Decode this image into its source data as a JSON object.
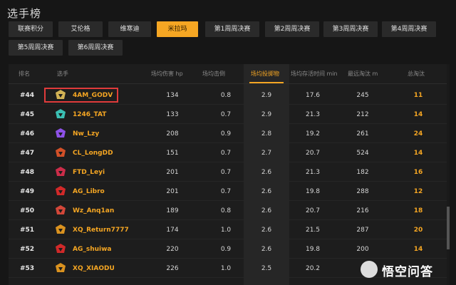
{
  "page": {
    "title": "选手榜"
  },
  "tabs": [
    {
      "label": "联赛积分",
      "active": false
    },
    {
      "label": "艾伦格",
      "active": false
    },
    {
      "label": "维寒迪",
      "active": false
    },
    {
      "label": "米拉玛",
      "active": true
    },
    {
      "label": "第1周周决赛",
      "active": false
    },
    {
      "label": "第2周周决赛",
      "active": false
    },
    {
      "label": "第3周周决赛",
      "active": false
    },
    {
      "label": "第4周周决赛",
      "active": false
    },
    {
      "label": "第5周周决赛",
      "active": false
    },
    {
      "label": "第6周周决赛",
      "active": false
    }
  ],
  "table": {
    "headers": [
      "排名",
      "选手",
      "场均伤害 hp",
      "场均击倒",
      "场均投掷物",
      "场均存活时间 min",
      "最远淘汰 m",
      "总淘汰"
    ],
    "sorted_column": "场均投掷物",
    "rows": [
      {
        "rank": "#44",
        "player": "4AM_GODV",
        "damage": "134",
        "knocks": "0.8",
        "throwables": "2.9",
        "survival": "17.6",
        "longest": "245",
        "kills": "11",
        "logo": "4am-logo"
      },
      {
        "rank": "#45",
        "player": "1246_TAT",
        "damage": "133",
        "knocks": "0.7",
        "throwables": "2.9",
        "survival": "21.3",
        "longest": "212",
        "kills": "14",
        "logo": "1246-logo"
      },
      {
        "rank": "#46",
        "player": "Nw_Lzy",
        "damage": "208",
        "knocks": "0.9",
        "throwables": "2.8",
        "survival": "19.2",
        "longest": "261",
        "kills": "24",
        "logo": "nw-logo"
      },
      {
        "rank": "#47",
        "player": "CL_LongDD",
        "damage": "151",
        "knocks": "0.7",
        "throwables": "2.7",
        "survival": "20.7",
        "longest": "524",
        "kills": "14",
        "logo": "cl-logo"
      },
      {
        "rank": "#48",
        "player": "FTD_Leyi",
        "damage": "201",
        "knocks": "0.7",
        "throwables": "2.6",
        "survival": "21.3",
        "longest": "182",
        "kills": "16",
        "logo": "ftd-logo"
      },
      {
        "rank": "#49",
        "player": "AG_Libro",
        "damage": "201",
        "knocks": "0.7",
        "throwables": "2.6",
        "survival": "19.8",
        "longest": "288",
        "kills": "12",
        "logo": "ag-logo"
      },
      {
        "rank": "#50",
        "player": "Wz_Anq1an",
        "damage": "189",
        "knocks": "0.8",
        "throwables": "2.6",
        "survival": "20.7",
        "longest": "216",
        "kills": "18",
        "logo": "wz-logo"
      },
      {
        "rank": "#51",
        "player": "XQ_Return7777",
        "damage": "174",
        "knocks": "1.0",
        "throwables": "2.6",
        "survival": "21.5",
        "longest": "287",
        "kills": "20",
        "logo": "xq-logo"
      },
      {
        "rank": "#52",
        "player": "AG_shuiwa",
        "damage": "220",
        "knocks": "0.9",
        "throwables": "2.6",
        "survival": "19.8",
        "longest": "200",
        "kills": "14",
        "logo": "ag-logo"
      },
      {
        "rank": "#53",
        "player": "XQ_XIAODU",
        "damage": "226",
        "knocks": "1.0",
        "throwables": "2.5",
        "survival": "20.2",
        "longest": "",
        "kills": "",
        "logo": "xq-logo"
      }
    ]
  },
  "watermark": {
    "text": "悟空问答"
  },
  "colors": {
    "accent": "#f5a623",
    "highlight_box": "#e03b3b",
    "background": "#161616"
  }
}
